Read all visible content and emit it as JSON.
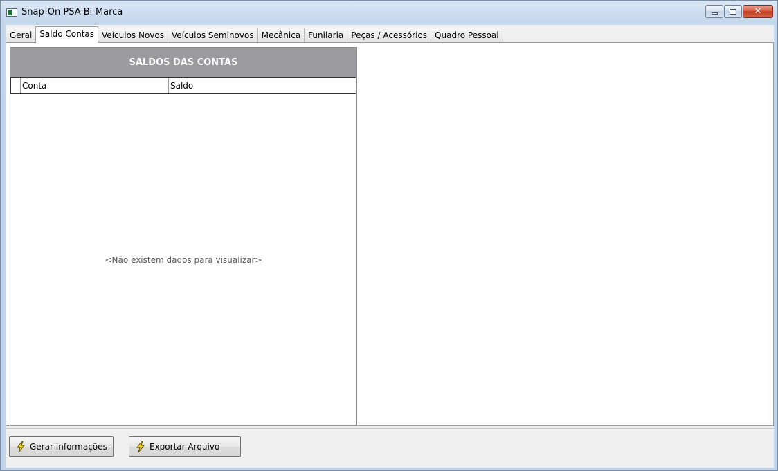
{
  "window": {
    "title": "Snap-On PSA Bi-Marca"
  },
  "tabs": [
    {
      "label": "Geral"
    },
    {
      "label": "Saldo Contas"
    },
    {
      "label": "Veículos Novos"
    },
    {
      "label": "Veículos Seminovos"
    },
    {
      "label": "Mecânica"
    },
    {
      "label": "Funilaria"
    },
    {
      "label": "Peças / Acessórios"
    },
    {
      "label": "Quadro Pessoal"
    }
  ],
  "active_tab": "Saldo Contas",
  "grid": {
    "title": "SALDOS DAS CONTAS",
    "columns": [
      "Conta",
      "Saldo"
    ],
    "empty_message": "<Não existem dados para visualizar>"
  },
  "buttons": {
    "generate": "Gerar Informações",
    "export": "Exportar Arquivo"
  },
  "icons": {
    "app": "app-icon",
    "bolt": "lightning-icon"
  },
  "colors": {
    "grid_header": "#9a9a9f",
    "bolt": "#f2d21b"
  }
}
